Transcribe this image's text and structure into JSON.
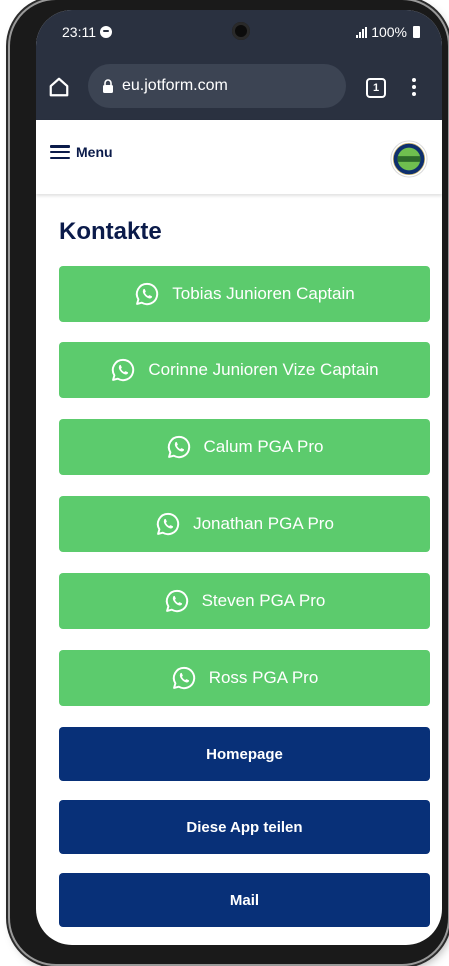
{
  "status_bar": {
    "time": "23:11",
    "battery": "100%"
  },
  "browser": {
    "url": "eu.jotform.com",
    "tab_count": "1"
  },
  "header": {
    "menu_label": "Menu",
    "logo_icon": "golf-club-logo"
  },
  "main": {
    "title": "Kontakte",
    "contacts": [
      {
        "label": "Tobias Junioren Captain",
        "icon": "whatsapp-icon"
      },
      {
        "label": "Corinne Junioren Vize Captain",
        "icon": "whatsapp-icon"
      },
      {
        "label": "Calum PGA Pro",
        "icon": "whatsapp-icon"
      },
      {
        "label": "Jonathan PGA Pro",
        "icon": "whatsapp-icon"
      },
      {
        "label": "Steven PGA Pro",
        "icon": "whatsapp-icon"
      },
      {
        "label": "Ross PGA Pro",
        "icon": "whatsapp-icon"
      }
    ],
    "links": [
      {
        "label": "Homepage"
      },
      {
        "label": "Diese App teilen"
      },
      {
        "label": "Mail"
      }
    ]
  },
  "colors": {
    "contact_button": "#5ccb6d",
    "link_button": "#083078",
    "title_text": "#0b1b4a",
    "browser_chrome": "#2a3140"
  }
}
